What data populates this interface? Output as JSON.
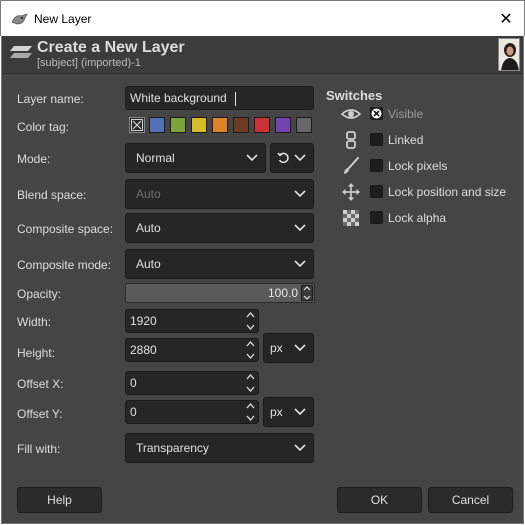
{
  "window": {
    "title": "New Layer",
    "close_label": "✕"
  },
  "header": {
    "title": "Create a New Layer",
    "subtitle": "[subject] (imported)-1"
  },
  "labels": {
    "layer_name": "Layer name:",
    "color_tag": "Color tag:",
    "mode": "Mode:",
    "blend_space": "Blend space:",
    "composite_space": "Composite space:",
    "composite_mode": "Composite mode:",
    "opacity": "Opacity:",
    "width": "Width:",
    "height": "Height:",
    "offset_x": "Offset X:",
    "offset_y": "Offset Y:",
    "fill_with": "Fill with:"
  },
  "fields": {
    "layer_name": "White background",
    "mode": "Normal",
    "blend_space": "Auto",
    "composite_space": "Auto",
    "composite_mode": "Auto",
    "opacity": "100.0",
    "width": "1920",
    "height": "2880",
    "height_unit": "px",
    "offset_x": "0",
    "offset_y": "0",
    "offset_unit": "px",
    "fill_with": "Transparency"
  },
  "color_tags": [
    {
      "name": "none",
      "color": "#2a2a2a"
    },
    {
      "name": "blue",
      "color": "#5470b6"
    },
    {
      "name": "green",
      "color": "#7ea33a"
    },
    {
      "name": "yellow",
      "color": "#d8bb2a"
    },
    {
      "name": "orange",
      "color": "#e0822a"
    },
    {
      "name": "brown",
      "color": "#6e3a22"
    },
    {
      "name": "red",
      "color": "#cc3235"
    },
    {
      "name": "violet",
      "color": "#7444b0"
    },
    {
      "name": "gray",
      "color": "#676767"
    }
  ],
  "switches": {
    "title": "Switches",
    "items": [
      {
        "label": "Visible",
        "icon": "eye-icon",
        "checked": true
      },
      {
        "label": "Linked",
        "icon": "chain-icon",
        "checked": false
      },
      {
        "label": "Lock pixels",
        "icon": "paintbrush-icon",
        "checked": false
      },
      {
        "label": "Lock position and size",
        "icon": "move-icon",
        "checked": false
      },
      {
        "label": "Lock alpha",
        "icon": "checkerboard-icon",
        "checked": false
      }
    ]
  },
  "buttons": {
    "help": "Help",
    "ok": "OK",
    "cancel": "Cancel"
  }
}
